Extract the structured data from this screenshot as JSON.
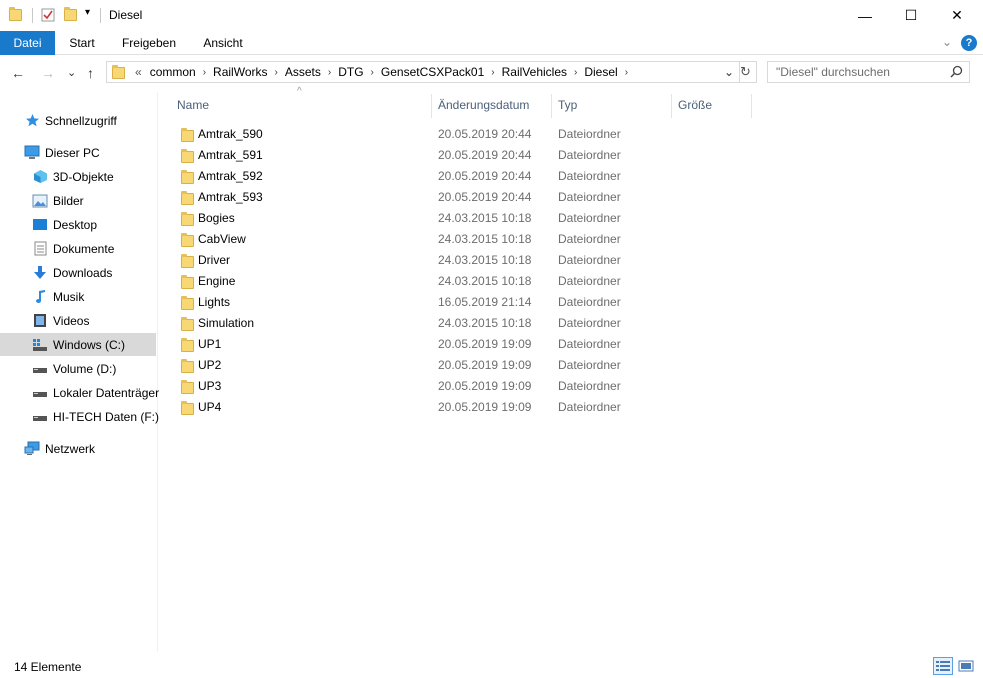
{
  "window": {
    "title": "Diesel",
    "controls": {
      "minimize": "—",
      "maximize": "☐",
      "close": "✕"
    }
  },
  "ribbon": {
    "tabs": [
      "Datei",
      "Start",
      "Freigeben",
      "Ansicht"
    ],
    "collapse_glyph": "⌄",
    "help_glyph": "?"
  },
  "navigation": {
    "back_glyph": "←",
    "forward_glyph": "→",
    "recent_glyph": "⌄",
    "up_glyph": "↑"
  },
  "address": {
    "overflow": "«",
    "crumbs": [
      "common",
      "RailWorks",
      "Assets",
      "DTG",
      "GensetCSXPack01",
      "RailVehicles",
      "Diesel"
    ],
    "dropdown_glyph": "⌄",
    "refresh_glyph": "↻"
  },
  "search": {
    "placeholder": "\"Diesel\" durchsuchen"
  },
  "sidebar": {
    "items": [
      {
        "label": "Schnellzugriff",
        "icon": "star-icon"
      },
      {
        "label": "Dieser PC",
        "icon": "computer-icon"
      },
      {
        "label": "3D-Objekte",
        "icon": "cube-icon"
      },
      {
        "label": "Bilder",
        "icon": "pictures-icon"
      },
      {
        "label": "Desktop",
        "icon": "desktop-icon"
      },
      {
        "label": "Dokumente",
        "icon": "document-icon"
      },
      {
        "label": "Downloads",
        "icon": "download-icon"
      },
      {
        "label": "Musik",
        "icon": "music-icon"
      },
      {
        "label": "Videos",
        "icon": "video-icon"
      },
      {
        "label": "Windows (C:)",
        "icon": "drive-icon"
      },
      {
        "label": "Volume (D:)",
        "icon": "drive-icon"
      },
      {
        "label": "Lokaler Datenträger",
        "icon": "drive-icon"
      },
      {
        "label": "HI-TECH Daten (F:)",
        "icon": "drive-icon"
      },
      {
        "label": "Netzwerk",
        "icon": "network-icon"
      }
    ]
  },
  "columns": {
    "name": "Name",
    "date": "Änderungsdatum",
    "type": "Typ",
    "size": "Größe",
    "sort_glyph": "^"
  },
  "files": [
    {
      "name": "Amtrak_590",
      "date": "20.05.2019 20:44",
      "type": "Dateiordner"
    },
    {
      "name": "Amtrak_591",
      "date": "20.05.2019 20:44",
      "type": "Dateiordner"
    },
    {
      "name": "Amtrak_592",
      "date": "20.05.2019 20:44",
      "type": "Dateiordner"
    },
    {
      "name": "Amtrak_593",
      "date": "20.05.2019 20:44",
      "type": "Dateiordner"
    },
    {
      "name": "Bogies",
      "date": "24.03.2015 10:18",
      "type": "Dateiordner"
    },
    {
      "name": "CabView",
      "date": "24.03.2015 10:18",
      "type": "Dateiordner"
    },
    {
      "name": "Driver",
      "date": "24.03.2015 10:18",
      "type": "Dateiordner"
    },
    {
      "name": "Engine",
      "date": "24.03.2015 10:18",
      "type": "Dateiordner"
    },
    {
      "name": "Lights",
      "date": "16.05.2019 21:14",
      "type": "Dateiordner"
    },
    {
      "name": "Simulation",
      "date": "24.03.2015 10:18",
      "type": "Dateiordner"
    },
    {
      "name": "UP1",
      "date": "20.05.2019 19:09",
      "type": "Dateiordner"
    },
    {
      "name": "UP2",
      "date": "20.05.2019 19:09",
      "type": "Dateiordner"
    },
    {
      "name": "UP3",
      "date": "20.05.2019 19:09",
      "type": "Dateiordner"
    },
    {
      "name": "UP4",
      "date": "20.05.2019 19:09",
      "type": "Dateiordner"
    }
  ],
  "status": {
    "text": "14 Elemente"
  },
  "colors": {
    "accent": "#1979ca",
    "folder": "#f8d775",
    "selected": "#d9d9d9",
    "header_text": "#4c607a",
    "secondary_text": "#6d6d6d"
  }
}
